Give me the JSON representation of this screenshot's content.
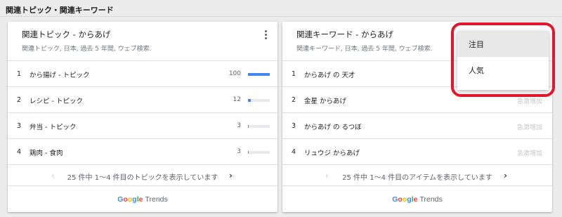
{
  "page": {
    "section_title": "関連トピック・関連キーワード"
  },
  "topics_card": {
    "title": "関連トピック - からあげ",
    "subtitle": "関連トピック, 日本, 過去 5 年間, ウェブ検索.",
    "rows": [
      {
        "rank": "1",
        "label": "から揚げ - トピック",
        "value": "100",
        "bar_percent": 100
      },
      {
        "rank": "2",
        "label": "レシピ - トピック",
        "value": "12",
        "bar_percent": 12
      },
      {
        "rank": "3",
        "label": "弁当 - トピック",
        "value": "3",
        "bar_percent": 3
      },
      {
        "rank": "4",
        "label": "鶏肉 - 食肉",
        "value": "3",
        "bar_percent": 3
      }
    ],
    "pager_text": "25 件中 1～4 件目のトピックを表示しています",
    "pager_prev_icon": "chevron-left-icon",
    "pager_next_icon": "chevron-right-icon"
  },
  "queries_card": {
    "title": "関連キーワード - からあげ",
    "subtitle": "関連キーワード, 日本, 過去 5 年間, ウェブ検索.",
    "rows": [
      {
        "rank": "1",
        "label": "からあげ の 天才",
        "value": ""
      },
      {
        "rank": "2",
        "label": "金星 からあげ",
        "value": "急激増加"
      },
      {
        "rank": "3",
        "label": "からあげ の るつぼ",
        "value": "急激増加"
      },
      {
        "rank": "4",
        "label": "リュウジ からあげ",
        "value": "急激増加"
      }
    ],
    "pager_text": "25 件中 1～4 件目のアイテムを表示しています",
    "pager_prev_icon": "chevron-left-icon",
    "pager_next_icon": "chevron-right-icon"
  },
  "footer": {
    "logo_letters": [
      "G",
      "o",
      "o",
      "g",
      "l",
      "e"
    ],
    "logo_suffix": "Trends"
  },
  "dropdown": {
    "options": [
      {
        "label": "注目",
        "selected": true
      },
      {
        "label": "人気",
        "selected": false
      }
    ]
  },
  "colors": {
    "bar": "#4285f4",
    "highlight_ring": "#e2182a",
    "breakout_text": "#c4c4c4"
  }
}
